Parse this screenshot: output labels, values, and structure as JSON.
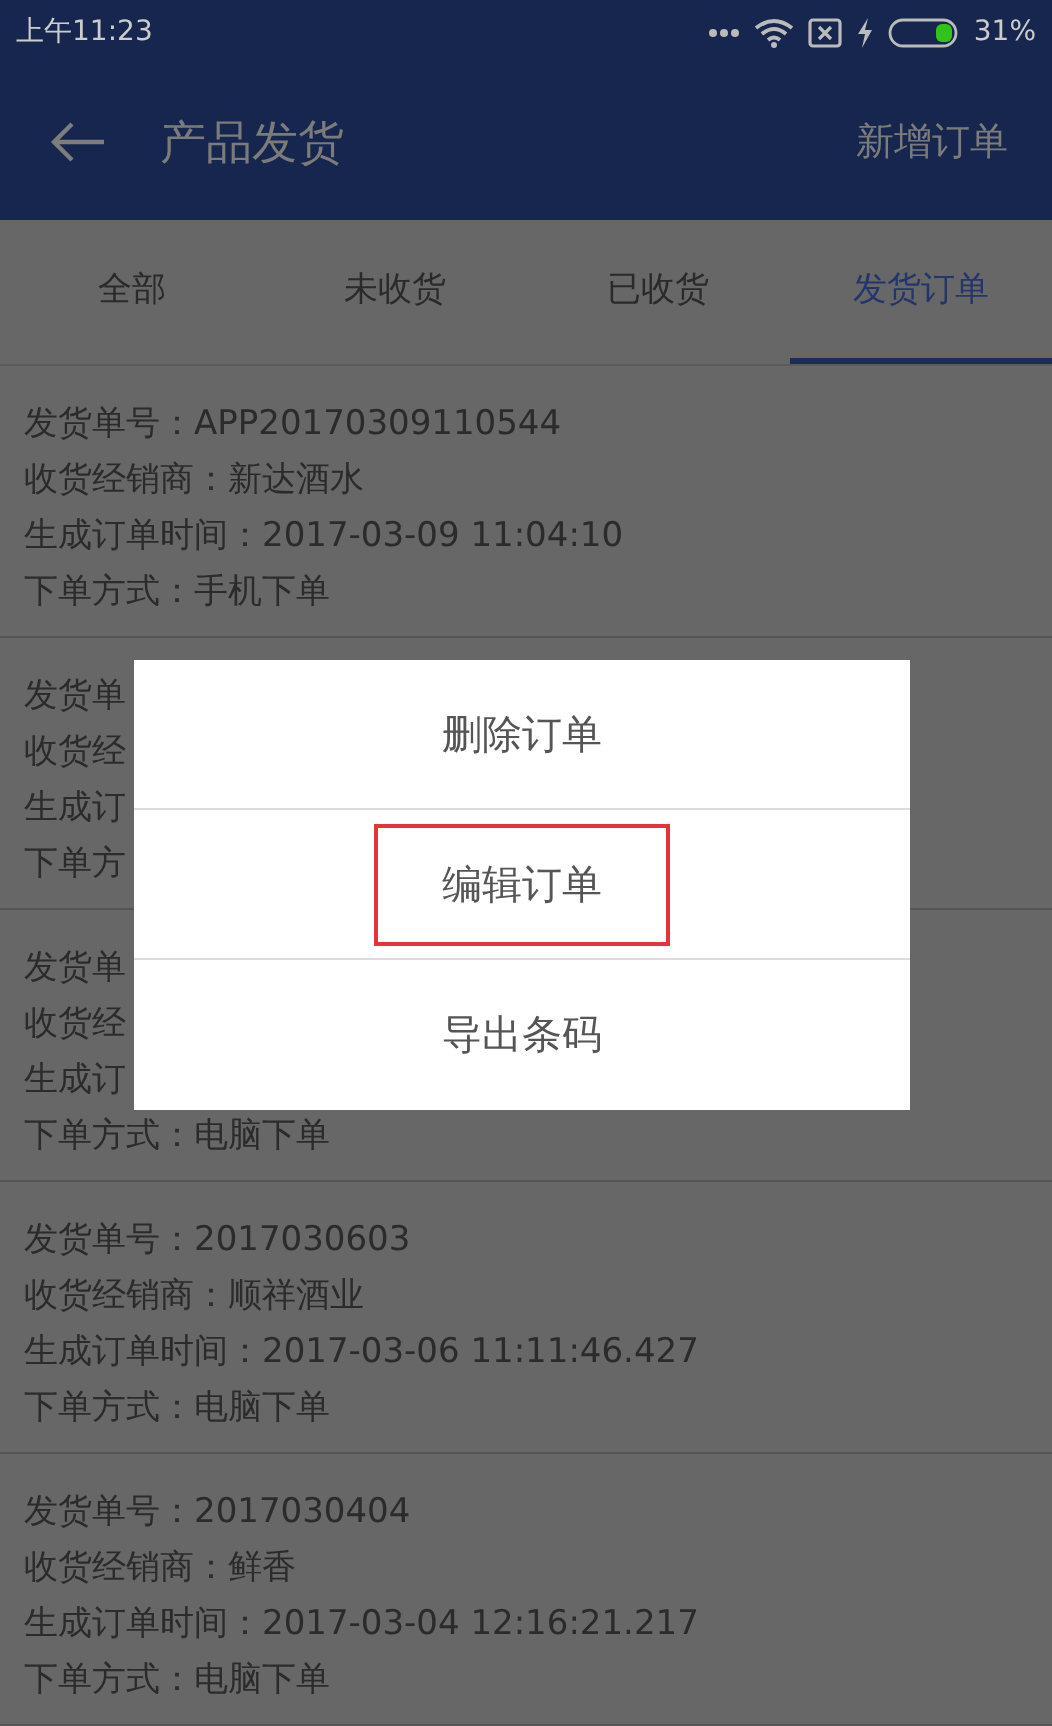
{
  "status_bar": {
    "time": "上午11:23",
    "battery": "31%"
  },
  "header": {
    "title": "产品发货",
    "action": "新增订单"
  },
  "tabs": [
    {
      "label": "全部",
      "selected": false
    },
    {
      "label": "未收货",
      "selected": false
    },
    {
      "label": "已收货",
      "selected": false
    },
    {
      "label": "发货订单",
      "selected": true
    }
  ],
  "orders": [
    {
      "lines": [
        "发货单号：APP20170309110544",
        "收货经销商：新达酒水",
        "生成订单时间：2017-03-09 11:04:10",
        "下单方式：手机下单"
      ]
    },
    {
      "lines": [
        "发货单",
        "收货经",
        "生成订",
        "下单方"
      ]
    },
    {
      "lines": [
        "发货单",
        "收货经",
        "生成订",
        "下单方式：电脑下单"
      ]
    },
    {
      "lines": [
        "发货单号：2017030603",
        "收货经销商：顺祥酒业",
        "生成订单时间：2017-03-06 11:11:46.427",
        "下单方式：电脑下单"
      ]
    },
    {
      "lines": [
        "发货单号：2017030404",
        "收货经销商：鲜香",
        "生成订单时间：2017-03-04 12:16:21.217",
        "下单方式：电脑下单"
      ]
    }
  ],
  "dialog": {
    "items": [
      {
        "label": "删除订单",
        "highlighted": false
      },
      {
        "label": "编辑订单",
        "highlighted": true
      },
      {
        "label": "导出条码",
        "highlighted": false
      }
    ]
  }
}
